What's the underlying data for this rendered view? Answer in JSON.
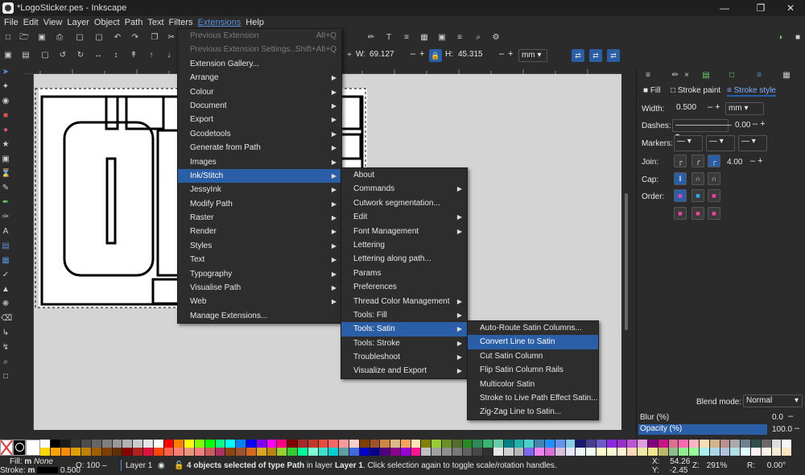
{
  "window": {
    "title": "*LogoSticker.pes - Inkscape"
  },
  "menubar": [
    "File",
    "Edit",
    "View",
    "Layer",
    "Object",
    "Path",
    "Text",
    "Filters",
    "Extensions",
    "Help"
  ],
  "toolbar": {
    "w_label": "W:",
    "w_value": "69.127",
    "h_label": "H:",
    "h_value": "45.315",
    "unit": "mm"
  },
  "extensions_menu": [
    {
      "label": "Previous Extension",
      "shortcut": "Alt+Q",
      "disabled": true
    },
    {
      "label": "Previous Extension Settings...",
      "shortcut": "Shift+Alt+Q",
      "disabled": true
    },
    {
      "label": "Extension Gallery..."
    },
    {
      "label": "Arrange",
      "sub": true
    },
    {
      "label": "Colour",
      "sub": true
    },
    {
      "label": "Document",
      "sub": true
    },
    {
      "label": "Export",
      "sub": true
    },
    {
      "label": "Gcodetools",
      "sub": true
    },
    {
      "label": "Generate from Path",
      "sub": true
    },
    {
      "label": "Images",
      "sub": true
    },
    {
      "label": "Ink/Stitch",
      "sub": true,
      "highlight": true
    },
    {
      "label": "JessyInk",
      "sub": true
    },
    {
      "label": "Modify Path",
      "sub": true
    },
    {
      "label": "Raster",
      "sub": true
    },
    {
      "label": "Render",
      "sub": true
    },
    {
      "label": "Styles",
      "sub": true
    },
    {
      "label": "Text",
      "sub": true
    },
    {
      "label": "Typography",
      "sub": true
    },
    {
      "label": "Visualise Path",
      "sub": true
    },
    {
      "label": "Web",
      "sub": true
    },
    {
      "label": "Manage Extensions..."
    }
  ],
  "inkstitch_menu": [
    {
      "label": "About"
    },
    {
      "label": "Commands",
      "sub": true
    },
    {
      "label": "Cutwork segmentation..."
    },
    {
      "label": "Edit",
      "sub": true
    },
    {
      "label": "Font Management",
      "sub": true
    },
    {
      "label": "Lettering"
    },
    {
      "label": "Lettering along path..."
    },
    {
      "label": "Params"
    },
    {
      "label": "Preferences"
    },
    {
      "label": "Thread Color Management",
      "sub": true
    },
    {
      "label": "Tools: Fill",
      "sub": true
    },
    {
      "label": "Tools: Satin",
      "sub": true,
      "highlight": true
    },
    {
      "label": "Tools: Stroke",
      "sub": true
    },
    {
      "label": "Troubleshoot",
      "sub": true
    },
    {
      "label": "Visualize and Export",
      "sub": true
    }
  ],
  "satin_menu": [
    {
      "label": "Auto-Route Satin Columns..."
    },
    {
      "label": "Convert Line to Satin",
      "highlight": true
    },
    {
      "label": "Cut Satin Column"
    },
    {
      "label": "Flip Satin Column Rails"
    },
    {
      "label": "Multicolor Satin"
    },
    {
      "label": "Stroke to Live Path Effect Satin..."
    },
    {
      "label": "Zig-Zag Line to Satin..."
    }
  ],
  "panel": {
    "tabs": [
      "Fill",
      "Stroke paint",
      "Stroke style"
    ],
    "width_label": "Width:",
    "width_value": "0.500",
    "width_unit": "mm",
    "dashes_label": "Dashes:",
    "dashes_value": "0.00",
    "markers_label": "Markers:",
    "join_label": "Join:",
    "join_value": "4.00",
    "cap_label": "Cap:",
    "order_label": "Order:",
    "blend_label": "Blend mode:",
    "blend_value": "Normal",
    "blur_label": "Blur (%)",
    "blur_value": "0.0",
    "opacity_label": "Opacity (%)",
    "opacity_value": "100.0"
  },
  "status": {
    "fill_label": "Fill:",
    "fill_value": "m",
    "fill_none": "None",
    "stroke_label": "Stroke:",
    "stroke_value": "m",
    "stroke_width": "0.500",
    "o_label": "O:",
    "o_value": "100",
    "layer": "Layer 1",
    "message_bold1": "4 objects selected of type ",
    "message_type": "Path",
    "message_mid": " in layer ",
    "message_layer": "Layer 1",
    "message_end": ". Click selection again to toggle scale/rotation handles.",
    "x_label": "X:",
    "x_value": "54.26",
    "y_label": "Y:",
    "y_value": "-2.45",
    "z_label": "Z:",
    "z_value": "291%",
    "r_label": "R:",
    "r_value": "0.00°"
  },
  "colors": {
    "accent": "#2a5fa8",
    "panel": "#2b2b2b",
    "canvas": "#d4d4d4"
  },
  "palette_top": [
    "#ffffff",
    "#000000",
    "#1a1a1a",
    "#333333",
    "#4d4d4d",
    "#666666",
    "#808080",
    "#999999",
    "#b3b3b3",
    "#cccccc",
    "#e6e6e6",
    "#ffffff",
    "#ff0000",
    "#ff7f00",
    "#ffff00",
    "#7fff00",
    "#00ff00",
    "#00ff7f",
    "#00ffff",
    "#007fff",
    "#0000ff",
    "#7f00ff",
    "#ff00ff",
    "#ff007f",
    "#800000",
    "#a52a2a",
    "#c0392b",
    "#e74c3c",
    "#ff6666",
    "#ff9999",
    "#ffcccc",
    "#804000",
    "#a0522d",
    "#cd853f",
    "#deb887",
    "#f4a460",
    "#ffe4b5",
    "#808000",
    "#9acd32",
    "#6b8e23",
    "#556b2f",
    "#228b22",
    "#2e8b57",
    "#3cb371",
    "#66cdaa",
    "#008080",
    "#20b2aa",
    "#48d1cc",
    "#4682b4",
    "#1e90ff",
    "#6495ed",
    "#87ceeb",
    "#191970",
    "#483d8b",
    "#6a5acd",
    "#8a2be2",
    "#9932cc",
    "#ba55d3",
    "#dda0dd",
    "#800080",
    "#c71585",
    "#db7093",
    "#ff69b4",
    "#ffb6c1",
    "#f5deb3",
    "#d2b48c",
    "#bc8f8f",
    "#a9a9a9",
    "#708090",
    "#2f4f4f",
    "#696969",
    "#dcdcdc",
    "#f5f5f5"
  ],
  "palette_bottom": [
    "#ffd700",
    "#ffa500",
    "#ff8c00",
    "#e0a000",
    "#c08000",
    "#a06000",
    "#804000",
    "#603000",
    "#8b0000",
    "#b22222",
    "#dc143c",
    "#ff4500",
    "#ff6347",
    "#fa8072",
    "#e9967a",
    "#f08080",
    "#cd5c5c",
    "#b03060",
    "#8b4513",
    "#a0522d",
    "#d2691e",
    "#daa520",
    "#b8860b",
    "#9acd32",
    "#32cd32",
    "#00fa9a",
    "#7fffd4",
    "#40e0d0",
    "#00ced1",
    "#5f9ea0",
    "#4169e1",
    "#0000cd",
    "#00008b",
    "#4b0082",
    "#8b008b",
    "#9400d3",
    "#ff1493",
    "#c0c0c0",
    "#a0a0a0",
    "#909090",
    "#787878",
    "#606060",
    "#484848",
    "#303030",
    "#e8e8e8",
    "#d0d0d0",
    "#b8b8b8",
    "#7b68ee",
    "#ee82ee",
    "#da70d6",
    "#d8bfd8",
    "#e6e6fa",
    "#f0f8ff",
    "#f0fff0",
    "#fffacd",
    "#fafad2",
    "#ffefd5",
    "#ffdab9",
    "#eee8aa",
    "#f0e68c",
    "#bdb76b",
    "#8fbc8f",
    "#90ee90",
    "#98fb98",
    "#afeeee",
    "#add8e6",
    "#b0c4de",
    "#b0e0e6",
    "#e0ffff",
    "#fff0f5",
    "#fdf5e6",
    "#faebd7",
    "#ffe4c4"
  ]
}
